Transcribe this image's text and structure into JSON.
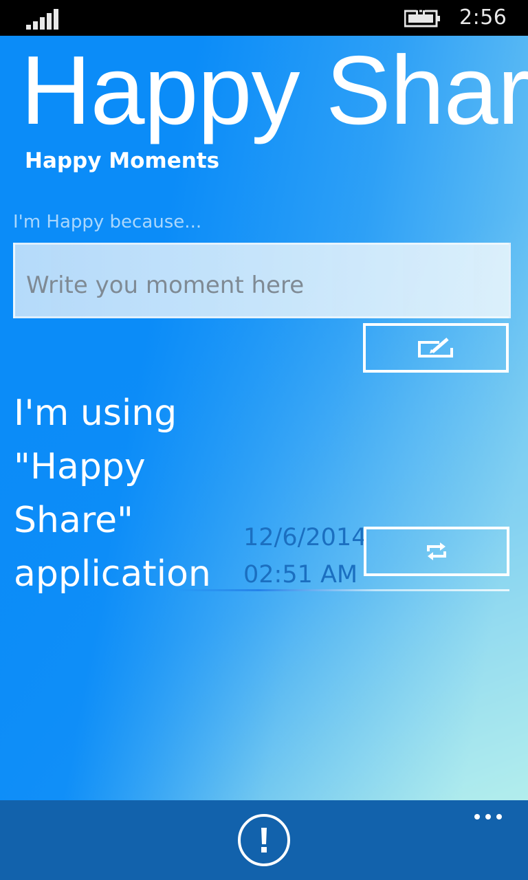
{
  "status_bar": {
    "time": "2:56",
    "icons": [
      "signal-strength-icon",
      "battery-charging-icon"
    ]
  },
  "app": {
    "title": "Happy Share",
    "subtitle": "Happy Moments"
  },
  "compose": {
    "label": "I'm Happy because...",
    "placeholder": "Write you moment here",
    "value": "",
    "post_icon": "edit-icon"
  },
  "moments": [
    {
      "text": "I'm using \"Happy Share\" application",
      "date": "12/6/2014",
      "time": "02:51 AM",
      "share_icon": "repeat-icon"
    }
  ],
  "app_bar": {
    "about_icon": "exclamation-circle-icon",
    "more_icon": "ellipsis-icon"
  },
  "colors": {
    "accent": "#0b8cf8",
    "app_bar": "#1262ac",
    "timestamp": "#1b6fc0"
  }
}
